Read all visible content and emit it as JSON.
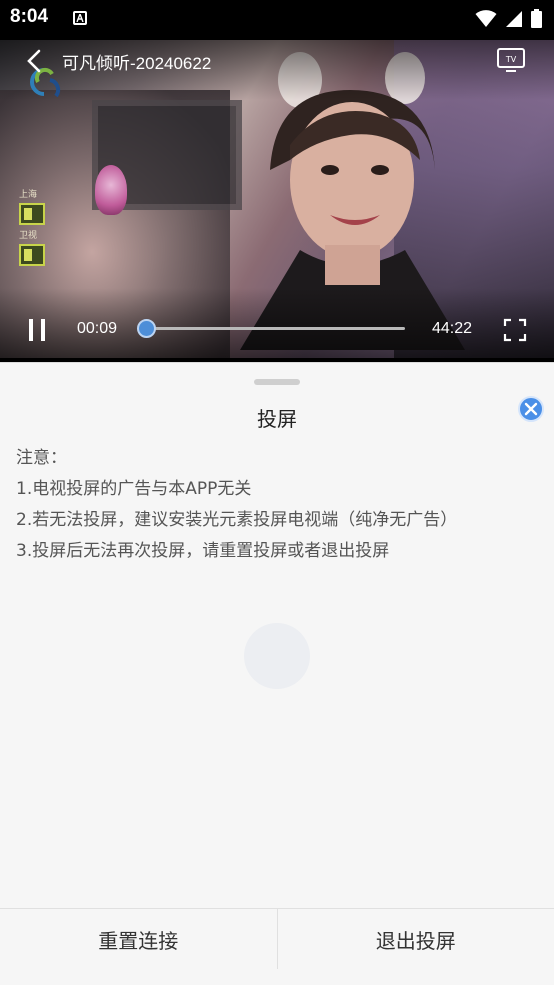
{
  "status_bar": {
    "time": "8:04",
    "icons": [
      "a-notification-icon",
      "wifi-icon",
      "signal-icon",
      "battery-icon"
    ]
  },
  "player": {
    "title": "可凡倾听-20240622",
    "channel_badges": [
      "上海",
      "卫视"
    ],
    "current_time": "00:09",
    "total_time": "44:22",
    "progress_fraction": 0.003,
    "state": "playing",
    "accent_color": "#4d8ed8"
  },
  "sheet": {
    "title": "投屏",
    "notice_heading": "注意：",
    "notices": [
      "1.电视投屏的广告与本APP无关",
      "2.若无法投屏，建议安装光元素投屏电视端（纯净无广告）",
      "3.投屏后无法再次投屏，请重置投屏或者退出投屏"
    ],
    "close_color": "#4a8fe7"
  },
  "actions": {
    "reset_label": "重置连接",
    "exit_label": "退出投屏"
  }
}
